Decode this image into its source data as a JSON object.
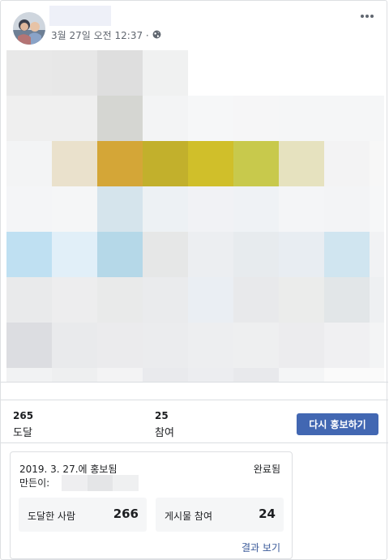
{
  "post": {
    "date_text": "3월 27일 오전 12:37 ·",
    "privacy_icon": "globe-icon",
    "more_icon": "more-horizontal-icon"
  },
  "media": {
    "description_colors": [
      [
        "#e8e8e8",
        "#e7e7e7",
        "#dedede",
        "#f0f1f1",
        "#ffffff",
        "#ffffff",
        "#ffffff",
        "#ffffff",
        "#ffffff"
      ],
      [
        "#efefef",
        "#efefef",
        "#d5d6d2",
        "#f3f4f5",
        "#f6f7f8",
        "#f6f6f7",
        "#f5f6f7",
        "#f5f6f7",
        "#f5f6f7"
      ],
      [
        "#f3f4f5",
        "#eae1cc",
        "#d4a637",
        "#c2b02c",
        "#d0bf2a",
        "#c8c94c",
        "#e6e2bf",
        "#f3f3f4",
        "#f7f7f7"
      ],
      [
        "#f4f5f7",
        "#f5f6f7",
        "#d5e4ec",
        "#edf1f4",
        "#f1f2f5",
        "#eff2f5",
        "#f4f5f7",
        "#f3f4f6",
        "#f6f7f8"
      ],
      [
        "#bfe0f2",
        "#e1eff8",
        "#b5d8e8",
        "#e6e7e7",
        "#eceef1",
        "#e7ebee",
        "#e8edf2",
        "#d0e5f0",
        "#f1f2f4"
      ],
      [
        "#e9eaeb",
        "#ededee",
        "#e9eaea",
        "#eaebed",
        "#eaeef3",
        "#e8e9eb",
        "#ebeceb",
        "#e2e6e8",
        "#eef0f2"
      ],
      [
        "#dcdde1",
        "#e9eaec",
        "#ebebed",
        "#ebecee",
        "#edeef0",
        "#eeeff0",
        "#ececee",
        "#f0f0f2",
        "#f3f4f5"
      ],
      [
        "#f1f2f3",
        "#eeeff0",
        "#f3f3f4",
        "#e9eaed",
        "#ecedf0",
        "#e8e9ec",
        "#f4f5f6",
        "#fafafa",
        "#fafafa"
      ]
    ]
  },
  "stats": {
    "reach_value": "265",
    "reach_label": "도달",
    "engagement_value": "25",
    "engagement_label": "참여",
    "boost_again_label": "다시 홍보하기"
  },
  "result": {
    "date_text": "2019. 3. 27.에 홍보됨",
    "status": "완료됨",
    "created_by_label": "만든이:",
    "reached_label": "도달한 사람",
    "reached_value": "266",
    "engagement_label": "게시물 참여",
    "engagement_value": "24",
    "view_results_label": "결과 보기"
  }
}
